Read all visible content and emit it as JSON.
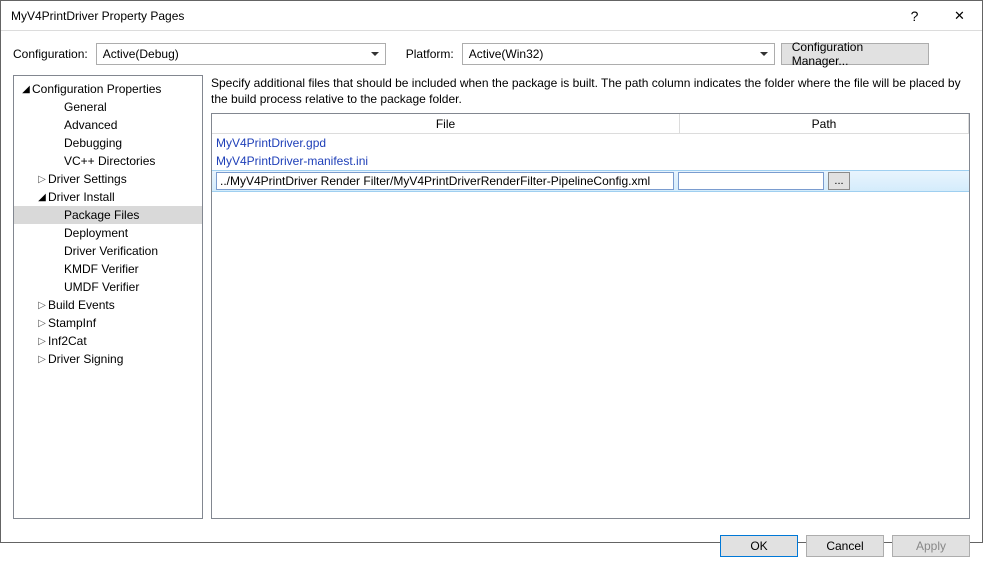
{
  "window": {
    "title": "MyV4PrintDriver Property Pages",
    "help_glyph": "?",
    "close_glyph": "✕"
  },
  "toolbar": {
    "config_label": "Configuration:",
    "config_value": "Active(Debug)",
    "platform_label": "Platform:",
    "platform_value": "Active(Win32)",
    "cfgmgr_label": "Configuration Manager..."
  },
  "tree": {
    "root_label": "Configuration Properties",
    "items": [
      {
        "label": "General",
        "indent": 2,
        "glyph": ""
      },
      {
        "label": "Advanced",
        "indent": 2,
        "glyph": ""
      },
      {
        "label": "Debugging",
        "indent": 2,
        "glyph": ""
      },
      {
        "label": "VC++ Directories",
        "indent": 2,
        "glyph": ""
      },
      {
        "label": "Driver Settings",
        "indent": 1,
        "glyph": "▷"
      },
      {
        "label": "Driver Install",
        "indent": 1,
        "glyph": "◢",
        "open": true
      },
      {
        "label": "Package Files",
        "indent": 2,
        "glyph": "",
        "selected": true
      },
      {
        "label": "Deployment",
        "indent": 2,
        "glyph": ""
      },
      {
        "label": "Driver Verification",
        "indent": 2,
        "glyph": ""
      },
      {
        "label": "KMDF Verifier",
        "indent": 2,
        "glyph": ""
      },
      {
        "label": "UMDF Verifier",
        "indent": 2,
        "glyph": ""
      },
      {
        "label": "Build Events",
        "indent": 1,
        "glyph": "▷"
      },
      {
        "label": "StampInf",
        "indent": 1,
        "glyph": "▷"
      },
      {
        "label": "Inf2Cat",
        "indent": 1,
        "glyph": "▷"
      },
      {
        "label": "Driver Signing",
        "indent": 1,
        "glyph": "▷"
      }
    ]
  },
  "description": "Specify additional files that should be included when the package is built.  The path column indicates the folder where the file will be placed by the build process relative to the package folder.",
  "grid": {
    "col_file": "File",
    "col_path": "Path",
    "rows": [
      {
        "file": "MyV4PrintDriver.gpd",
        "path": ""
      },
      {
        "file": "MyV4PrintDriver-manifest.ini",
        "path": ""
      }
    ],
    "editing_row": {
      "file": "../MyV4PrintDriver Render Filter/MyV4PrintDriverRenderFilter-PipelineConfig.xml",
      "path": "",
      "browse_label": "..."
    }
  },
  "footer": {
    "ok": "OK",
    "cancel": "Cancel",
    "apply": "Apply"
  }
}
